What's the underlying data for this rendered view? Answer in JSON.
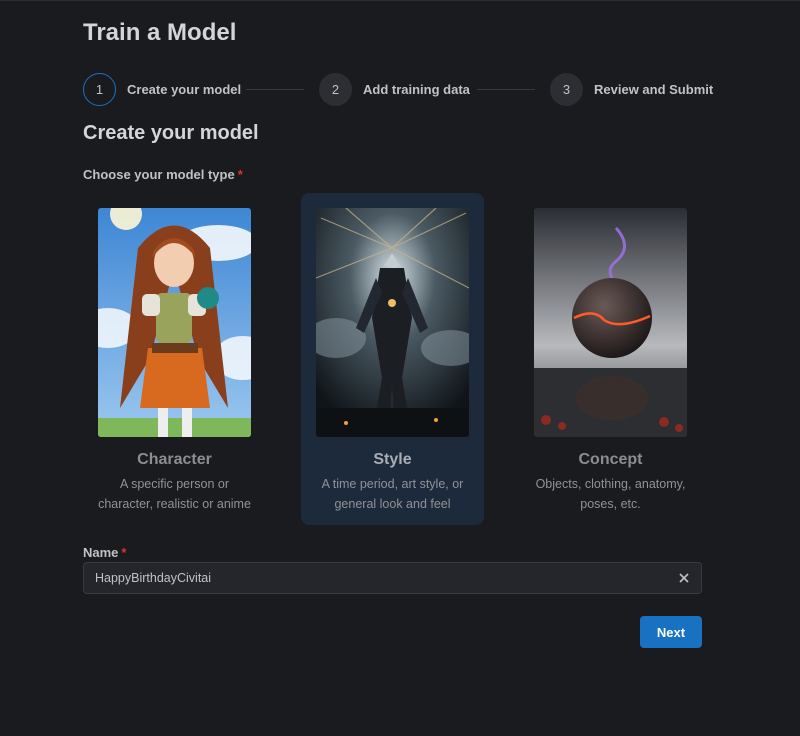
{
  "page": {
    "title": "Train a Model"
  },
  "stepper": {
    "steps": [
      {
        "number": "1",
        "label": "Create your model",
        "active": true
      },
      {
        "number": "2",
        "label": "Add training data",
        "active": false
      },
      {
        "number": "3",
        "label": "Review and Submit",
        "active": false
      }
    ]
  },
  "section": {
    "title": "Create your model"
  },
  "model_type": {
    "label": "Choose your model type",
    "required_mark": "*",
    "options": [
      {
        "title": "Character",
        "description": "A specific person or character, realistic or anime",
        "image": "anime-girl-thumbnail",
        "selected": false
      },
      {
        "title": "Style",
        "description": "A time period, art style, or general look and feel",
        "image": "mecha-robot-thumbnail",
        "selected": true
      },
      {
        "title": "Concept",
        "description": "Objects, clothing, anatomy, poses, etc.",
        "image": "cracked-sphere-thumbnail",
        "selected": false
      }
    ]
  },
  "name_field": {
    "label": "Name",
    "required_mark": "*",
    "value": "HappyBirthdayCivitai",
    "clear_icon": "close-icon"
  },
  "actions": {
    "next_label": "Next"
  },
  "colors": {
    "accent": "#1971c2",
    "background": "#1a1b1e",
    "selected_card": "#1c2a3b",
    "required": "#e03131"
  }
}
